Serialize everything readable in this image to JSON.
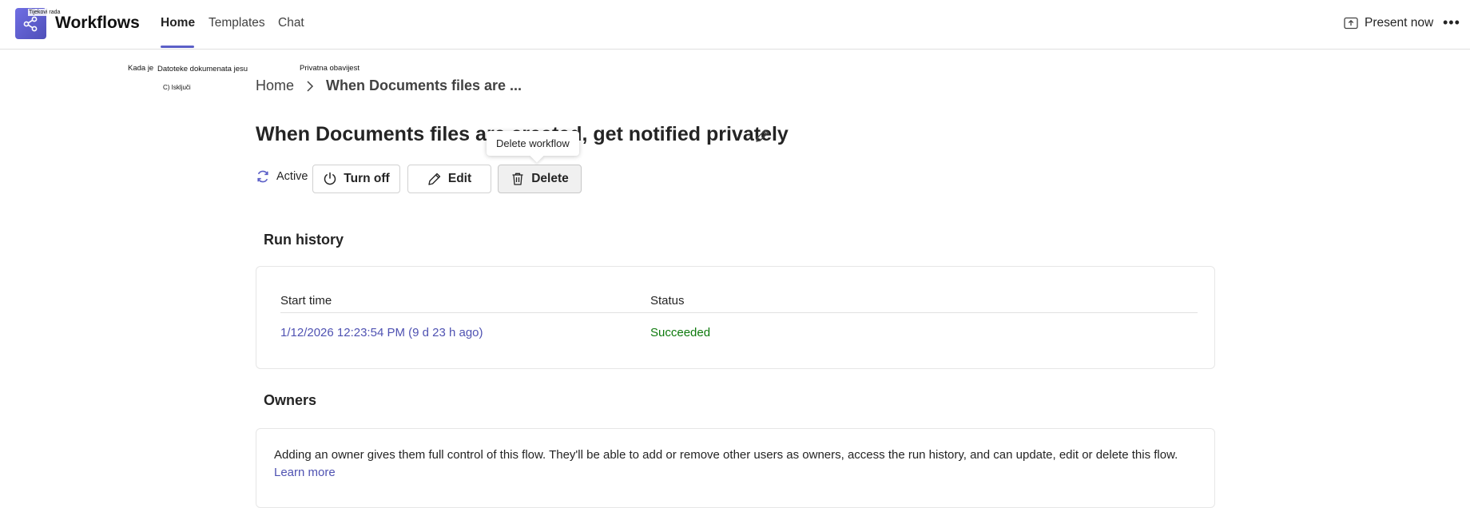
{
  "header": {
    "app_icon_label": "Tijekovi rada",
    "app_title": "Workflows",
    "tabs": [
      "Home",
      "Templates",
      "Chat"
    ],
    "active_tab": "Home",
    "present_label": "Present now",
    "more_label": "•••"
  },
  "overlay_labels": {
    "kada_je": "Kada je",
    "datoteke": "Datoteke dokumenata jesu",
    "privatna": "Privatna obavijest",
    "iskljuci": "C) Isključi"
  },
  "breadcrumb": {
    "home": "Home",
    "current": "When Documents files are ..."
  },
  "page_title": "When Documents files are created, get notified privately",
  "tooltip": "Delete workflow",
  "actions": {
    "status": "Active",
    "turn_off": "Turn off",
    "edit": "Edit",
    "delete": "Delete"
  },
  "run_history": {
    "heading": "Run history",
    "columns": [
      "Start time",
      "Status"
    ],
    "rows": [
      {
        "start_time": "1/12/2026 12:23:54 PM (9 d 23 h ago)",
        "status": "Succeeded"
      }
    ]
  },
  "owners": {
    "heading": "Owners",
    "description": "Adding an owner gives them full control of this flow. They'll be able to add or remove other users as owners, access the run history, and can update, edit or delete this flow.",
    "learn_more": "Learn more"
  },
  "colors": {
    "accent": "#5b5fc7",
    "link": "#4f52b2",
    "success": "#0e7a0d"
  }
}
